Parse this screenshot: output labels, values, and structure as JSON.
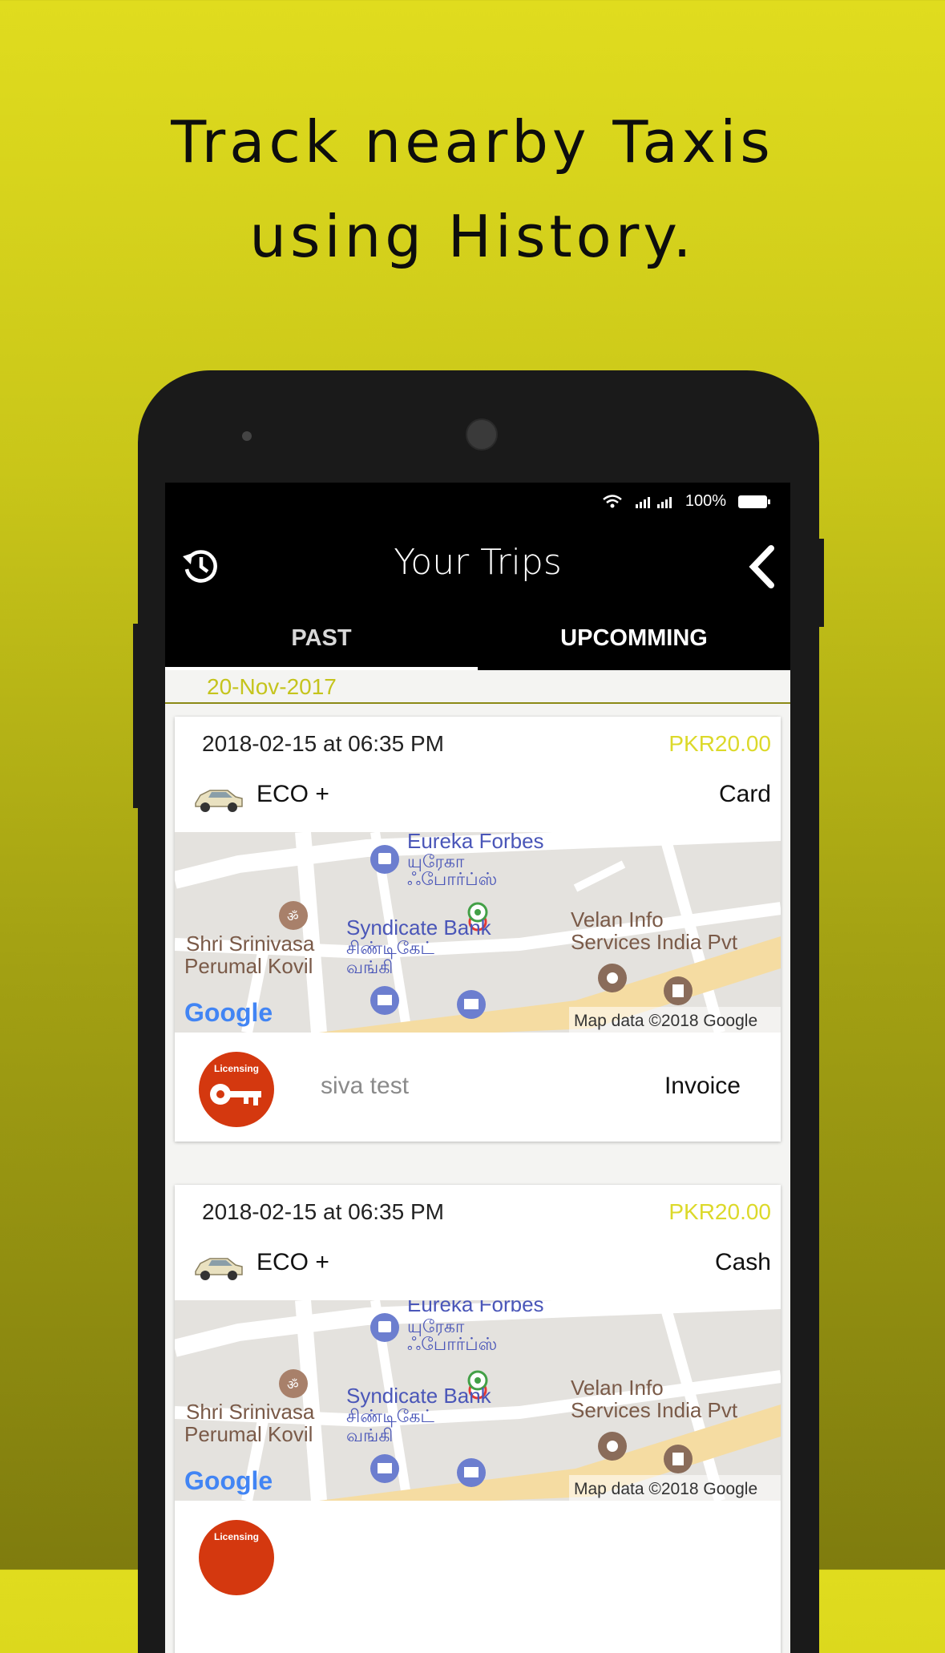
{
  "headline": {
    "line1": "Track nearby Taxis",
    "line2": "using History."
  },
  "status_bar": {
    "battery": "100%"
  },
  "app_bar": {
    "title": "Your Trips",
    "history_icon": "history-icon",
    "back_icon": "chevron-left-icon"
  },
  "tabs": [
    {
      "label": "PAST",
      "selected": true
    },
    {
      "label": "UPCOMMING",
      "selected": false
    }
  ],
  "date_header": "20-Nov-2017",
  "colors": {
    "accent": "#dcd92a",
    "license_badge": "#d4380f",
    "toolbar": "#000000"
  },
  "map_labels": {
    "place1": "Eureka Forbes",
    "place1_tamil1": "யுரேகா",
    "place1_tamil2": "ஃபோர்ப்ஸ்",
    "place2": "Syndicate Bank",
    "place2_tamil1": "சிண்டிகேட்",
    "place2_tamil2": "வங்கி",
    "place3_line1": "Velan Info",
    "place3_line2": "Services India Pvt",
    "place4_line1": "Shri Srinivasa",
    "place4_line2": "Perumal Kovil",
    "attribution": "Map data ©2018 Google",
    "google": "Google"
  },
  "trips": [
    {
      "datetime": "2018-02-15 at 06:35 PM",
      "price": "PKR20.00",
      "car_type": "ECO +",
      "payment": "Card",
      "badge_text": "Licensing",
      "driver": "siva test",
      "action": "Invoice"
    },
    {
      "datetime": "2018-02-15 at 06:35 PM",
      "price": "PKR20.00",
      "car_type": "ECO +",
      "payment": "Cash",
      "badge_text": "Licensing",
      "driver": "",
      "action": ""
    }
  ]
}
